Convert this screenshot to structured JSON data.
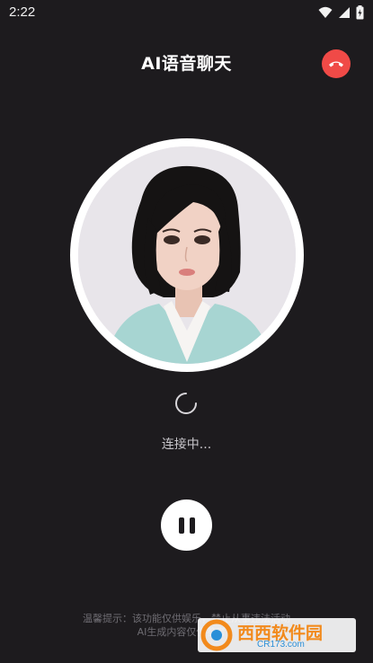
{
  "status_bar": {
    "time": "2:22"
  },
  "header": {
    "title": "AI语音聊天"
  },
  "call": {
    "status_text": "连接中..."
  },
  "footer": {
    "tip_line1": "温馨提示：该功能仅供娱乐，禁止从事违法活动",
    "tip_line2": "AI生成内容仅供参考，"
  },
  "watermark": {
    "brand": "西西软件园",
    "site": "CR173.com"
  },
  "colors": {
    "background": "#1d1b1e",
    "hangup": "#f04a47",
    "brand_orange": "#f28a1c"
  }
}
